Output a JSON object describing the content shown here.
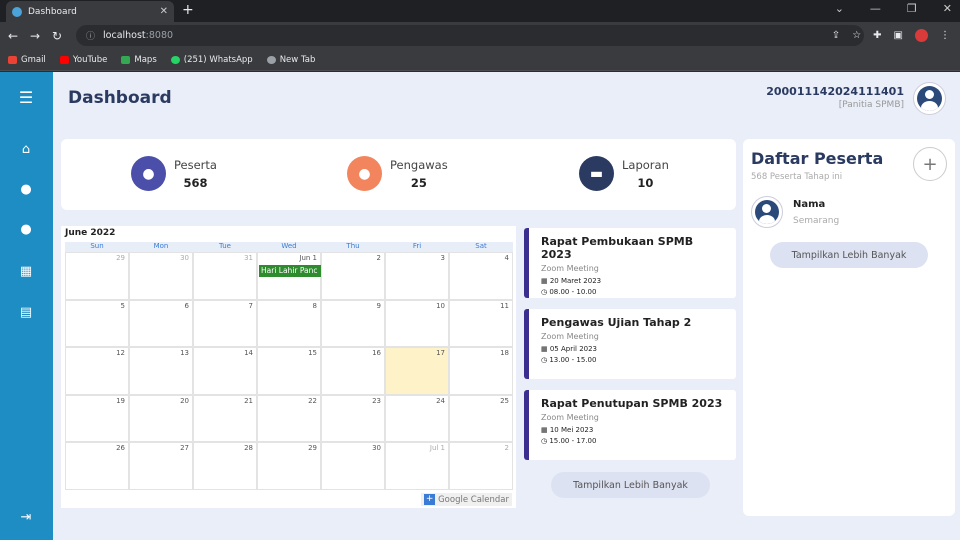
{
  "browser": {
    "tab_title": "Dashboard",
    "url_host": "localhost",
    "url_port": ":8080",
    "bookmarks": [
      {
        "label": "Gmail",
        "color": "#ea4335"
      },
      {
        "label": "YouTube",
        "color": "#ff0000"
      },
      {
        "label": "Maps",
        "color": "#34a853"
      },
      {
        "label": "(251) WhatsApp",
        "color": "#25d366"
      },
      {
        "label": "New Tab",
        "color": "#9aa0a6"
      }
    ]
  },
  "header": {
    "title": "Dashboard",
    "user_id": "200011142024111401",
    "user_role": "[Panitia SPMB]"
  },
  "stats": {
    "peserta_label": "Peserta",
    "peserta_value": "568",
    "peserta_color": "#4b4faa",
    "pengawas_label": "Pengawas",
    "pengawas_value": "25",
    "pengawas_color": "#f2855e",
    "laporan_label": "Laporan",
    "laporan_value": "10",
    "laporan_color": "#2b3a60"
  },
  "calendar": {
    "month_title": "June 2022",
    "weekdays": [
      "Sun",
      "Mon",
      "Tue",
      "Wed",
      "Thu",
      "Fri",
      "Sat"
    ],
    "weeks": [
      [
        "29",
        "30",
        "31",
        "Jun 1",
        "2",
        "3",
        "4"
      ],
      [
        "5",
        "6",
        "7",
        "8",
        "9",
        "10",
        "11"
      ],
      [
        "12",
        "13",
        "14",
        "15",
        "16",
        "17",
        "18"
      ],
      [
        "19",
        "20",
        "21",
        "22",
        "23",
        "24",
        "25"
      ],
      [
        "26",
        "27",
        "28",
        "29",
        "30",
        "Jul 1",
        "2"
      ]
    ],
    "event_label": "Hari Lahir Panc",
    "footer_label": "Google Calendar"
  },
  "agenda": [
    {
      "title": "Rapat Pembukaan SPMB 2023",
      "subtitle": "Zoom Meeting",
      "date": "20 Maret 2023",
      "time": "08.00 - 10.00"
    },
    {
      "title": "Pengawas Ujian Tahap 2",
      "subtitle": "Zoom Meeting",
      "date": "05 April 2023",
      "time": "13.00 - 15.00"
    },
    {
      "title": "Rapat Penutupan SPMB 2023",
      "subtitle": "Zoom Meeting",
      "date": "10 Mei 2023",
      "time": "15.00 - 17.00"
    }
  ],
  "agenda_more": "Tampilkan Lebih Banyak",
  "panel": {
    "title": "Daftar Peserta",
    "subtitle": "568 Peserta Tahap ini",
    "person_name": "Nama",
    "person_city": "Semarang",
    "more": "Tampilkan Lebih Banyak"
  }
}
